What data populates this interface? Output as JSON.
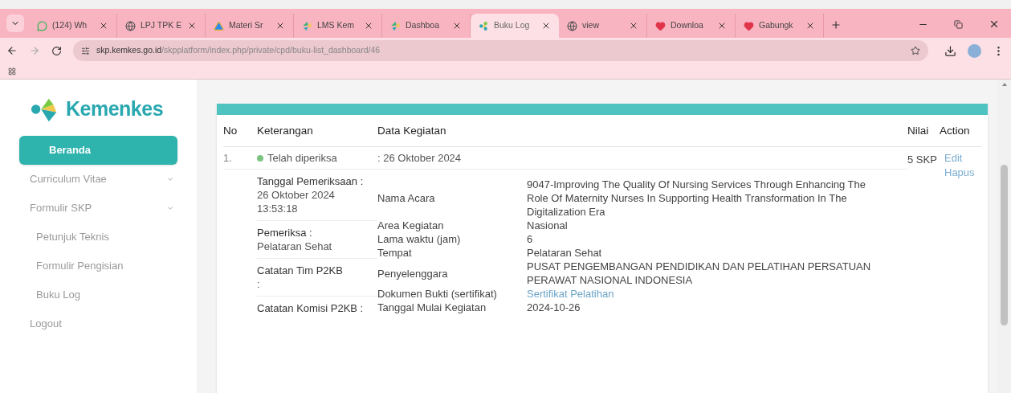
{
  "browser": {
    "tabs": [
      {
        "title": "(124) Wh",
        "kind": "chat",
        "selected": false
      },
      {
        "title": "LPJ TPK E",
        "kind": "globe",
        "selected": false
      },
      {
        "title": "Materi Sr",
        "kind": "triangle",
        "selected": false
      },
      {
        "title": "LMS Kem",
        "kind": "leaf",
        "selected": false
      },
      {
        "title": "Dashboa",
        "kind": "leaf",
        "selected": false
      },
      {
        "title": "Buku Log",
        "kind": "flower",
        "selected": true
      },
      {
        "title": "view",
        "kind": "globe",
        "selected": false
      },
      {
        "title": "Downloa",
        "kind": "heart",
        "selected": false
      },
      {
        "title": "Gabungk",
        "kind": "heart",
        "selected": false
      }
    ],
    "url": {
      "host": "skp.kemkes.go.id",
      "path": "/skpplatform/index.php/private/cpd/buku-list_dashboard/46"
    }
  },
  "sidebar": {
    "logo_text": "Kemenkes",
    "items": [
      {
        "label": "Beranda",
        "selected": true,
        "expandable": false
      },
      {
        "label": "Curriculum Vitae",
        "selected": false,
        "expandable": true
      },
      {
        "label": "Formulir SKP",
        "selected": false,
        "expandable": true,
        "children": [
          {
            "label": "Petunjuk Teknis",
            "selected": false,
            "expandable": false
          },
          {
            "label": "Formulir Pengisian",
            "selected": false,
            "expandable": false
          },
          {
            "label": "Buku Log",
            "selected": false,
            "expandable": false
          }
        ]
      },
      {
        "label": "Logout",
        "selected": false,
        "expandable": false
      }
    ]
  },
  "table": {
    "columns": [
      "No",
      "Keterangan",
      "Data Kegiatan",
      "Nilai",
      "Action"
    ],
    "rows": [
      {
        "no": "1.",
        "status": {
          "label": "Telah diperiksa",
          "color": "#7cc47f"
        },
        "date": ": 26 Oktober 2024",
        "review": [
          {
            "label": "Tanggal Pemeriksaan :",
            "value": "26 Oktober 2024 13:53:18"
          },
          {
            "label": "Pemeriksa :",
            "value": "Pelataran Sehat"
          },
          {
            "label": "Catatan Tim P2KB",
            "value": ":"
          },
          {
            "label": "Catatan Komisi P2KB :"
          }
        ],
        "details": [
          {
            "label": "Nama Acara",
            "value": "9047-Improving The Quality Of Nursing Services Through Enhancing The Role Of Maternity Nurses In Supporting Health Transformation In The Digitalization Era",
            "kind": "text"
          },
          {
            "label": "Area Kegiatan",
            "value": "Nasional",
            "kind": "text"
          },
          {
            "label": "Lama waktu (jam)",
            "value": "6",
            "kind": "text"
          },
          {
            "label": "Tempat",
            "value": "Pelataran Sehat",
            "kind": "text"
          },
          {
            "label": "Penyelenggara",
            "value": "PUSAT PENGEMBANGAN PENDIDIKAN DAN PELATIHAN PERSATUAN PERAWAT NASIONAL INDONESIA",
            "kind": "text"
          },
          {
            "label": "Dokumen Bukti (sertifikat)",
            "value": "Sertifikat Pelatihan",
            "kind": "link"
          },
          {
            "label": "Tanggal Mulai Kegiatan",
            "value": "2024-10-26",
            "kind": "text"
          }
        ],
        "nilai": "5 SKP",
        "actions": [
          "Edit",
          "Hapus"
        ]
      }
    ]
  }
}
